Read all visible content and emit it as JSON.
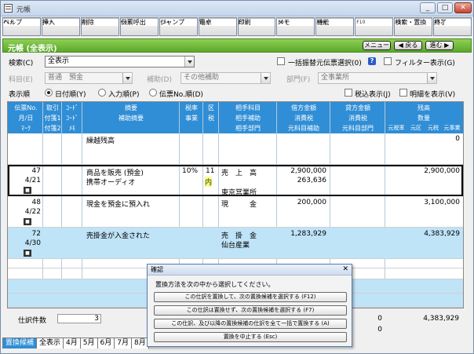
{
  "window": {
    "title": "元帳",
    "min_label": "_",
    "max_label": "□",
    "close_label": "✕"
  },
  "fkeys": [
    {
      "label": "ヘルプ",
      "key": "F1+"
    },
    {
      "label": "挿入",
      "key": "F2+"
    },
    {
      "label": "削除",
      "key": "F3"
    },
    {
      "label": "伝票呼出",
      "key": "F4+"
    },
    {
      "label": "ジャンプ",
      "key": "F5+"
    },
    {
      "label": "電卓",
      "key": "F6+"
    },
    {
      "label": "印刷",
      "key": "F7+"
    },
    {
      "label": "メモ",
      "key": "F8+"
    },
    {
      "label": "機能",
      "key": "F9+"
    },
    {
      "label": "",
      "key": "F10"
    },
    {
      "label": "検索・置換",
      "key": "F11"
    },
    {
      "label": "終了",
      "key": "F12"
    }
  ],
  "header": {
    "title": "元帳 (全表示)",
    "menu_label": "メニュー",
    "back_label": "◀ 戻る",
    "forward_label": "進む ▶"
  },
  "search": {
    "label": "検索(C)",
    "value": "全表示",
    "bulk_label": "一括振替元伝票選択(0)",
    "help": "?",
    "filter_label": "フィルター表示(G)"
  },
  "filters": {
    "account_label": "科目(E)",
    "account_value": "普通　預金",
    "sub_label": "補助(D)",
    "sub_value": "その他補助",
    "dept_label": "部門(F)",
    "dept_value": "全事業所"
  },
  "order": {
    "label": "表示順",
    "opt1": "日付順(Y)",
    "opt2": "入力順(P)",
    "opt3": "伝票No.順(D)",
    "tax_label": "税込表示(J)",
    "detail_label": "明細を表示(V)"
  },
  "columns": {
    "r1": [
      "伝票No.",
      "取引",
      "ｺｰﾄﾞ",
      "摘要",
      "税率",
      "区",
      "相手科目",
      "借方金額",
      "貸方金額",
      "残高"
    ],
    "r2": [
      "月/日",
      "付箋1",
      "ｺｰﾄﾞ",
      "補助摘要",
      "事業",
      "税",
      "相手補助",
      "消費税",
      "消費税",
      "数量"
    ],
    "r3": [
      "ﾏｰｸ",
      "付箋2",
      "ﾒﾓ",
      "",
      "",
      "",
      "相手部門",
      "元科目補助",
      "元科目部門",
      "元税率",
      "元区",
      "元税",
      "元事業"
    ]
  },
  "rows": [
    {
      "memo": "繰越残高",
      "balance": "0"
    },
    {
      "no": "47",
      "date": "4/21",
      "mark": "■",
      "memo": "商品を販売 (預金)",
      "submemo": "携帯オーディオ",
      "rate": "10%",
      "code": "11",
      "tax": "内",
      "acct": "売　上　高",
      "dept": "東京営業所",
      "debit": "2,900,000",
      "vat": "263,636",
      "balance": "2,900,000"
    },
    {
      "no": "48",
      "date": "4/22",
      "mark": "■",
      "memo": "現金を預金に預入れ",
      "acct": "現　　　金",
      "debit": "200,000",
      "balance": "3,100,000"
    },
    {
      "no": "72",
      "date": "4/30",
      "mark": "■",
      "memo": "売掛金が入金された",
      "acct": "売　掛　金",
      "sub": "仙台産業",
      "debit": "1,283,929",
      "balance": "4,383,929"
    }
  ],
  "footer": {
    "count_label": "仕訳件数",
    "count": "3",
    "debit_total": "0",
    "credit_total": "0",
    "balance": "4,383,929"
  },
  "tabs": [
    "置換候補",
    "全表示",
    "4月",
    "5月",
    "6月",
    "7月",
    "8月"
  ],
  "dialog": {
    "title": "確認",
    "close": "✕",
    "message": "置換方法を次の中から選択してください。",
    "btn1": "この仕訳を置換して、次の置換候補を選択する (F12)",
    "btn2": "この仕訳は置換せず、次の置換候補を選択する (F7)",
    "btn3": "この仕訳、及び以降の置換候補の仕訳を全て一括で置換する (A)",
    "btn4": "置換を中止する (Esc)"
  },
  "colors": {
    "accent": "#2f8ed6",
    "green": "#5aa82a",
    "row_highlight": "#bfe3f7"
  }
}
